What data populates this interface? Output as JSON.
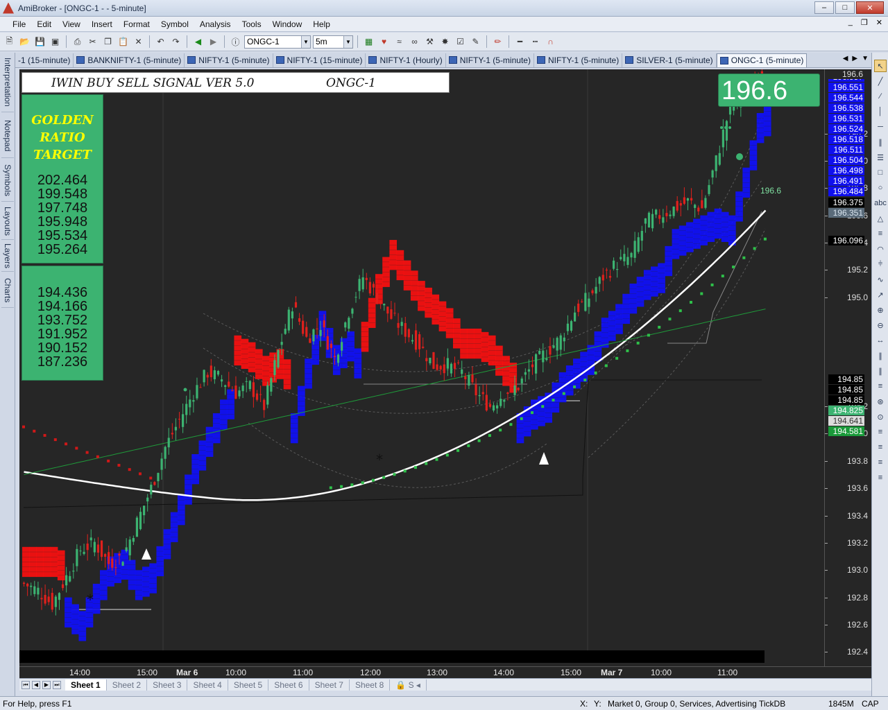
{
  "window": {
    "title": "AmiBroker - [ONGC-1 -  - 5-minute]",
    "min": "–",
    "max": "□",
    "close": "✕"
  },
  "menu": [
    "File",
    "Edit",
    "View",
    "Insert",
    "Format",
    "Symbol",
    "Analysis",
    "Tools",
    "Window",
    "Help"
  ],
  "mdi_controls": [
    "_",
    "❐",
    "✕"
  ],
  "toolbar": {
    "symbol": "ONGC-1",
    "interval": "5m"
  },
  "left_tabs": [
    "Interpretation",
    "Notepad",
    "Symbols",
    "Layouts",
    "Layers",
    "Charts"
  ],
  "chart_tabs": [
    {
      "label": "-1 (15-minute)",
      "active": false
    },
    {
      "label": "BANKNIFTY-1 (5-minute)",
      "active": false
    },
    {
      "label": "NIFTY-1 (5-minute)",
      "active": false
    },
    {
      "label": "NIFTY-1 (15-minute)",
      "active": false
    },
    {
      "label": "NIFTY-1 (Hourly)",
      "active": false
    },
    {
      "label": "NIFTY-1 (5-minute)",
      "active": false
    },
    {
      "label": "NIFTY-1 (5-minute)",
      "active": false
    },
    {
      "label": "SILVER-1 (5-minute)",
      "active": false
    },
    {
      "label": "ONGC-1 (5-minute)",
      "active": true
    }
  ],
  "overlay": {
    "indicator_title": "IWIN BUY SELL SIGNAL VER 5.0",
    "symbol": "ONGC-1",
    "golden": [
      "GOLDEN",
      "RATIO",
      "TARGET"
    ],
    "targets_up": [
      "202.464",
      "199.548",
      "197.748",
      "195.948",
      "195.534",
      "195.264"
    ],
    "targets_down": [
      "194.436",
      "194.166",
      "193.752",
      "191.952",
      "190.152",
      "187.236"
    ],
    "ltp": "196.6",
    "last_label": "196.6"
  },
  "price_axis": {
    "ticks": [
      "196.2",
      "196.0",
      "195.8",
      "195.6",
      "195.4",
      "195.2",
      "195.0",
      "194.2",
      "194.0",
      "193.8",
      "193.6",
      "193.4",
      "193.2",
      "193.0",
      "192.8",
      "192.6",
      "192.4"
    ],
    "top_cut": "196.6",
    "blue_boxes": [
      "196.557",
      "196.551",
      "196.544",
      "196.538",
      "196.531",
      "196.524",
      "196.518",
      "196.511",
      "196.504",
      "196.498",
      "196.491",
      "196.484"
    ],
    "black_boxes": [
      "196.375",
      "196.096",
      "194.85",
      "194.85",
      "194.85"
    ],
    "grey_boxes": [
      "196.351",
      "194.641"
    ],
    "green_boxes": [
      "194.825",
      "194.581"
    ]
  },
  "time_axis": [
    "14:00",
    "15:00",
    "Mar 6",
    "10:00",
    "11:00",
    "12:00",
    "13:00",
    "14:00",
    "15:00",
    "Mar 7",
    "10:00",
    "11:00"
  ],
  "sheets": [
    "Sheet 1",
    "Sheet 2",
    "Sheet 3",
    "Sheet 4",
    "Sheet 5",
    "Sheet 6",
    "Sheet 7",
    "Sheet 8"
  ],
  "status": {
    "help": "For Help, press F1",
    "x": "X:",
    "y": "Y:",
    "info": "Market 0, Group 0, Services, Advertising",
    "db": "TickDB",
    "mem": "1845M",
    "cap": "CAP"
  },
  "colors": {
    "bg": "#262626",
    "bull": "#3cb371",
    "bear": "#e0201c",
    "band_blue": "#1010ff",
    "band_red": "#ff1010"
  },
  "chart_data": {
    "type": "candlestick",
    "symbol": "ONGC-1",
    "interval": "5-minute",
    "ylim": [
      192.3,
      196.65
    ],
    "x_labels": [
      "14:00",
      "15:00",
      "Mar 6",
      "10:00",
      "11:00",
      "12:00",
      "13:00",
      "14:00",
      "15:00",
      "Mar 7",
      "10:00",
      "11:00"
    ],
    "close_path": [
      [
        0,
        192.9
      ],
      [
        4,
        192.85
      ],
      [
        8,
        192.75
      ],
      [
        12,
        192.95
      ],
      [
        16,
        193.15
      ],
      [
        20,
        193.2
      ],
      [
        24,
        193.05
      ],
      [
        28,
        193.1
      ],
      [
        32,
        193.35
      ],
      [
        36,
        193.6
      ],
      [
        40,
        193.9
      ],
      [
        44,
        194.1
      ],
      [
        48,
        194.3
      ],
      [
        52,
        194.45
      ],
      [
        56,
        194.4
      ],
      [
        60,
        194.3
      ],
      [
        64,
        194.35
      ],
      [
        68,
        194.2
      ],
      [
        72,
        194.6
      ],
      [
        76,
        194.95
      ],
      [
        80,
        194.7
      ],
      [
        84,
        194.8
      ],
      [
        88,
        194.55
      ],
      [
        92,
        194.9
      ],
      [
        96,
        195.15
      ],
      [
        100,
        195.0
      ],
      [
        104,
        194.85
      ],
      [
        108,
        194.75
      ],
      [
        112,
        194.65
      ],
      [
        116,
        194.5
      ],
      [
        120,
        194.5
      ],
      [
        124,
        194.45
      ],
      [
        128,
        194.3
      ],
      [
        132,
        194.2
      ],
      [
        136,
        194.3
      ],
      [
        140,
        194.35
      ],
      [
        144,
        194.5
      ],
      [
        148,
        194.6
      ],
      [
        152,
        194.7
      ],
      [
        156,
        194.9
      ],
      [
        160,
        195.0
      ],
      [
        164,
        195.15
      ],
      [
        168,
        195.25
      ],
      [
        172,
        195.3
      ],
      [
        176,
        195.55
      ],
      [
        180,
        195.6
      ],
      [
        184,
        195.65
      ],
      [
        188,
        195.7
      ],
      [
        192,
        195.65
      ],
      [
        196,
        196.0
      ],
      [
        200,
        196.4
      ],
      [
        204,
        196.5
      ],
      [
        208,
        196.6
      ],
      [
        210,
        196.6
      ]
    ],
    "n_bars": 211
  }
}
